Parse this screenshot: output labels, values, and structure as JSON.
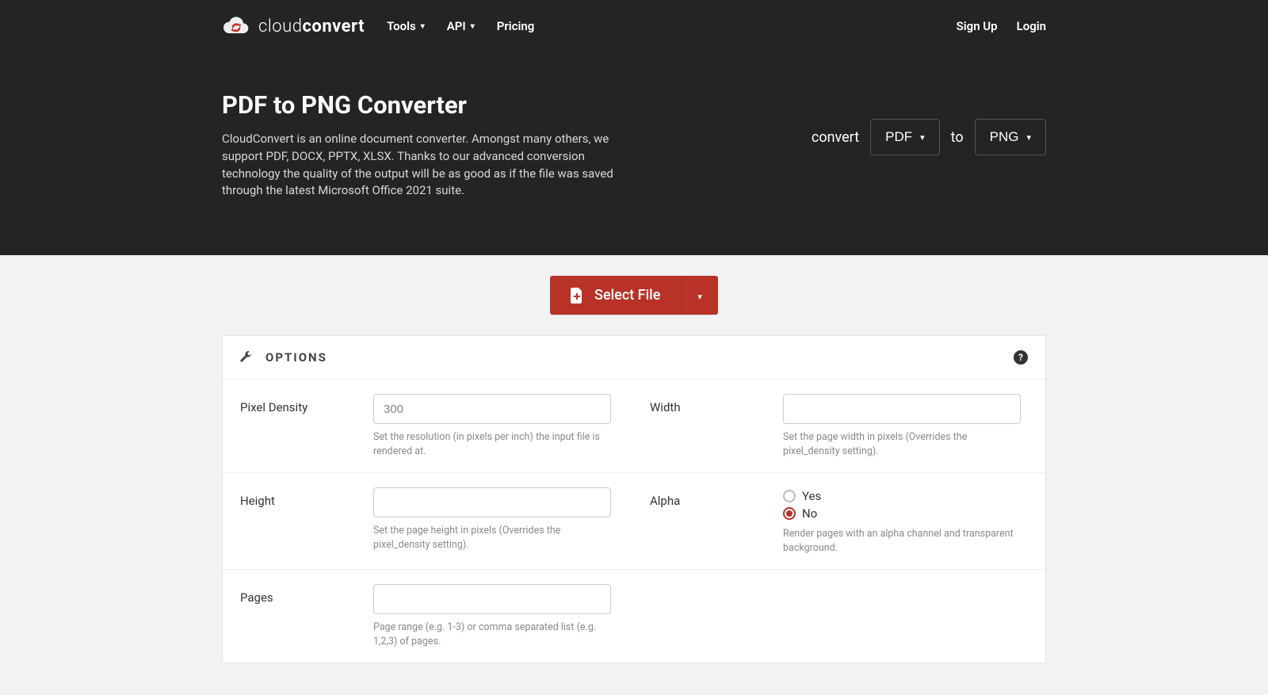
{
  "brand": {
    "light": "cloud",
    "bold": "convert"
  },
  "nav": {
    "tools": "Tools",
    "api": "API",
    "pricing": "Pricing",
    "signup": "Sign Up",
    "login": "Login"
  },
  "hero": {
    "title": "PDF to PNG Converter",
    "desc": "CloudConvert is an online document converter. Amongst many others, we support PDF, DOCX, PPTX, XLSX. Thanks to our advanced conversion technology the quality of the output will be as good as if the file was saved through the latest Microsoft Office 2021 suite.",
    "convert_label": "convert",
    "to_label": "to",
    "from_fmt": "PDF",
    "to_fmt": "PNG"
  },
  "select_file": {
    "label": "Select File"
  },
  "options": {
    "title": "OPTIONS",
    "pixel_density": {
      "label": "Pixel Density",
      "placeholder": "300",
      "help": "Set the resolution (in pixels per inch) the input file is rendered at."
    },
    "width": {
      "label": "Width",
      "help": "Set the page width in pixels (Overrides the pixel_density setting)."
    },
    "height": {
      "label": "Height",
      "help": "Set the page height in pixels (Overrides the pixel_density setting)."
    },
    "alpha": {
      "label": "Alpha",
      "yes": "Yes",
      "no": "No",
      "selected": "no",
      "help": "Render pages with an alpha channel and transparent background."
    },
    "pages": {
      "label": "Pages",
      "help": "Page range (e.g. 1-3) or comma separated list (e.g. 1,2,3) of pages."
    }
  }
}
